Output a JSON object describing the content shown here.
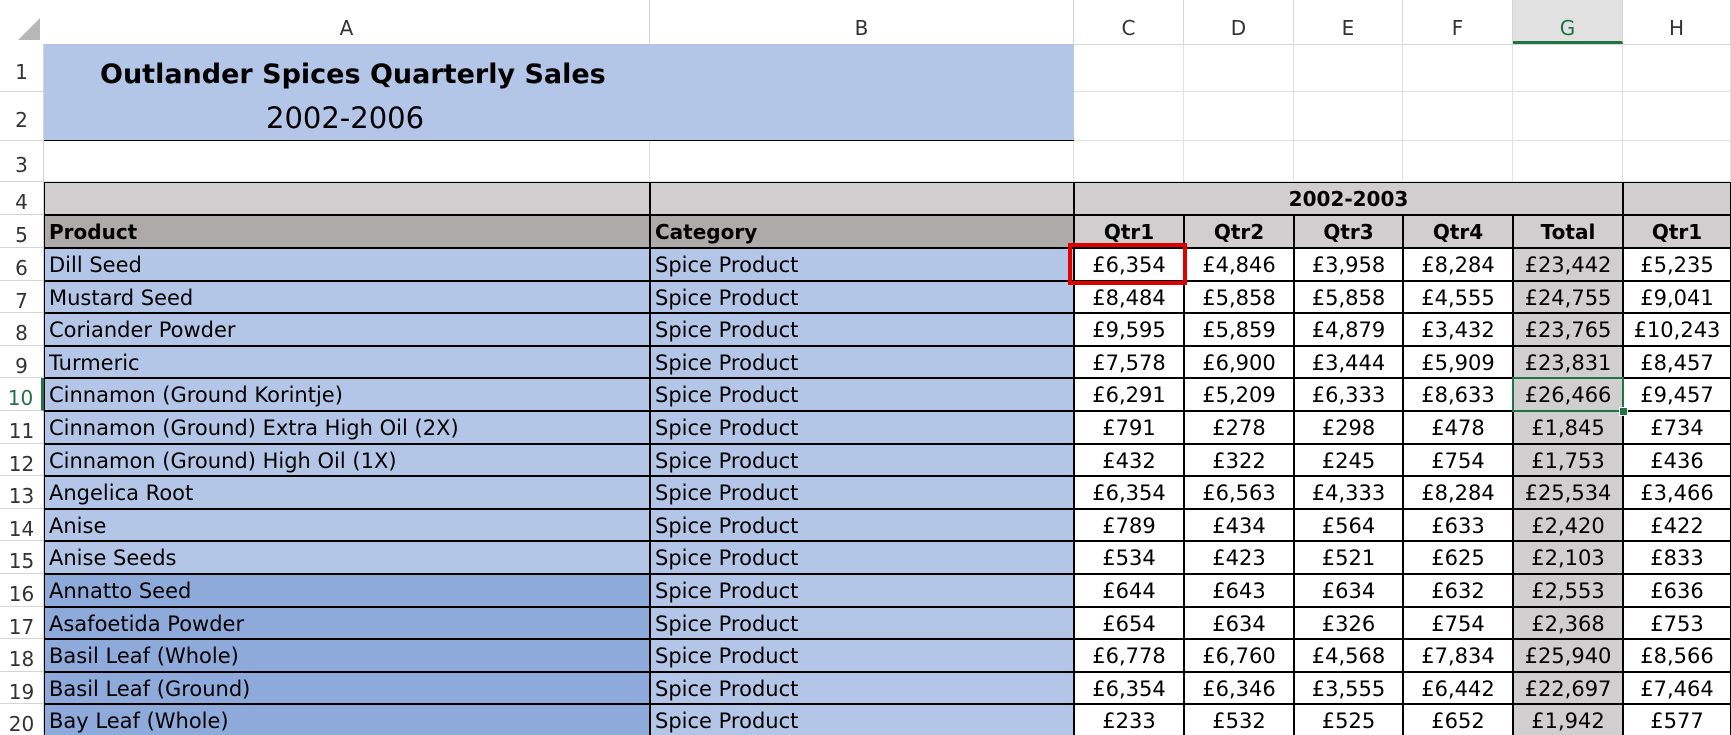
{
  "columns": [
    "A",
    "B",
    "C",
    "D",
    "E",
    "F",
    "G",
    "H"
  ],
  "selected_column": "G",
  "selected_row": "10",
  "rows": [
    "1",
    "2",
    "3",
    "4",
    "5",
    "6",
    "7",
    "8",
    "9",
    "10",
    "11",
    "12",
    "13",
    "14",
    "15",
    "16",
    "17",
    "18",
    "19",
    "20"
  ],
  "title": "Outlander Spices Quarterly Sales",
  "subtitle": "2002-2006",
  "group_header": "2002-2003",
  "header": {
    "product": "Product",
    "category": "Category",
    "quarters": [
      "Qtr1",
      "Qtr2",
      "Qtr3",
      "Qtr4",
      "Total",
      "Qtr1"
    ]
  },
  "table": [
    {
      "product": "Dill Seed",
      "category": "Spice Product",
      "values": [
        "£6,354",
        "£4,846",
        "£3,958",
        "£8,284",
        "£23,442",
        "£5,235"
      ]
    },
    {
      "product": "Mustard Seed",
      "category": "Spice Product",
      "values": [
        "£8,484",
        "£5,858",
        "£5,858",
        "£4,555",
        "£24,755",
        "£9,041"
      ]
    },
    {
      "product": "Coriander Powder",
      "category": "Spice Product",
      "values": [
        "£9,595",
        "£5,859",
        "£4,879",
        "£3,432",
        "£23,765",
        "£10,243"
      ]
    },
    {
      "product": "Turmeric",
      "category": "Spice Product",
      "values": [
        "£7,578",
        "£6,900",
        "£3,444",
        "£5,909",
        "£23,831",
        "£8,457"
      ]
    },
    {
      "product": "Cinnamon (Ground Korintje)",
      "category": "Spice Product",
      "values": [
        "£6,291",
        "£5,209",
        "£6,333",
        "£8,633",
        "£26,466",
        "£9,457"
      ]
    },
    {
      "product": "Cinnamon (Ground) Extra High Oil (2X)",
      "category": "Spice Product",
      "values": [
        "£791",
        "£278",
        "£298",
        "£478",
        "£1,845",
        "£734"
      ]
    },
    {
      "product": "Cinnamon (Ground) High Oil (1X)",
      "category": "Spice Product",
      "values": [
        "£432",
        "£322",
        "£245",
        "£754",
        "£1,753",
        "£436"
      ]
    },
    {
      "product": "Angelica Root",
      "category": "Spice Product",
      "values": [
        "£6,354",
        "£6,563",
        "£4,333",
        "£8,284",
        "£25,534",
        "£3,466"
      ]
    },
    {
      "product": "Anise",
      "category": "Spice Product",
      "values": [
        "£789",
        "£434",
        "£564",
        "£633",
        "£2,420",
        "£422"
      ]
    },
    {
      "product": "Anise Seeds",
      "category": "Spice Product",
      "values": [
        "£534",
        "£423",
        "£521",
        "£625",
        "£2,103",
        "£833"
      ]
    },
    {
      "product": "Annatto Seed",
      "category": "Spice Product",
      "values": [
        "£644",
        "£643",
        "£634",
        "£632",
        "£2,553",
        "£636"
      ]
    },
    {
      "product": "Asafoetida Powder",
      "category": "Spice Product",
      "values": [
        "£654",
        "£634",
        "£326",
        "£754",
        "£2,368",
        "£753"
      ]
    },
    {
      "product": "Basil Leaf (Whole)",
      "category": "Spice Product",
      "values": [
        "£6,778",
        "£6,760",
        "£4,568",
        "£7,834",
        "£25,940",
        "£8,566"
      ]
    },
    {
      "product": "Basil Leaf (Ground)",
      "category": "Spice Product",
      "values": [
        "£6,354",
        "£6,346",
        "£3,555",
        "£6,442",
        "£22,697",
        "£7,464"
      ]
    },
    {
      "product": "Bay Leaf (Whole)",
      "category": "Spice Product",
      "values": [
        "£233",
        "£532",
        "£525",
        "£652",
        "£1,942",
        "£577"
      ]
    }
  ],
  "colors": {
    "title_fill": "#b4c6e7",
    "product_fill_light": "#b4c6e7",
    "product_fill_dark": "#8eaadb",
    "header_fill": "#d0cece",
    "header_dark_fill": "#aeaaaa",
    "highlight_border": "#e00000",
    "selection": "#217346"
  }
}
